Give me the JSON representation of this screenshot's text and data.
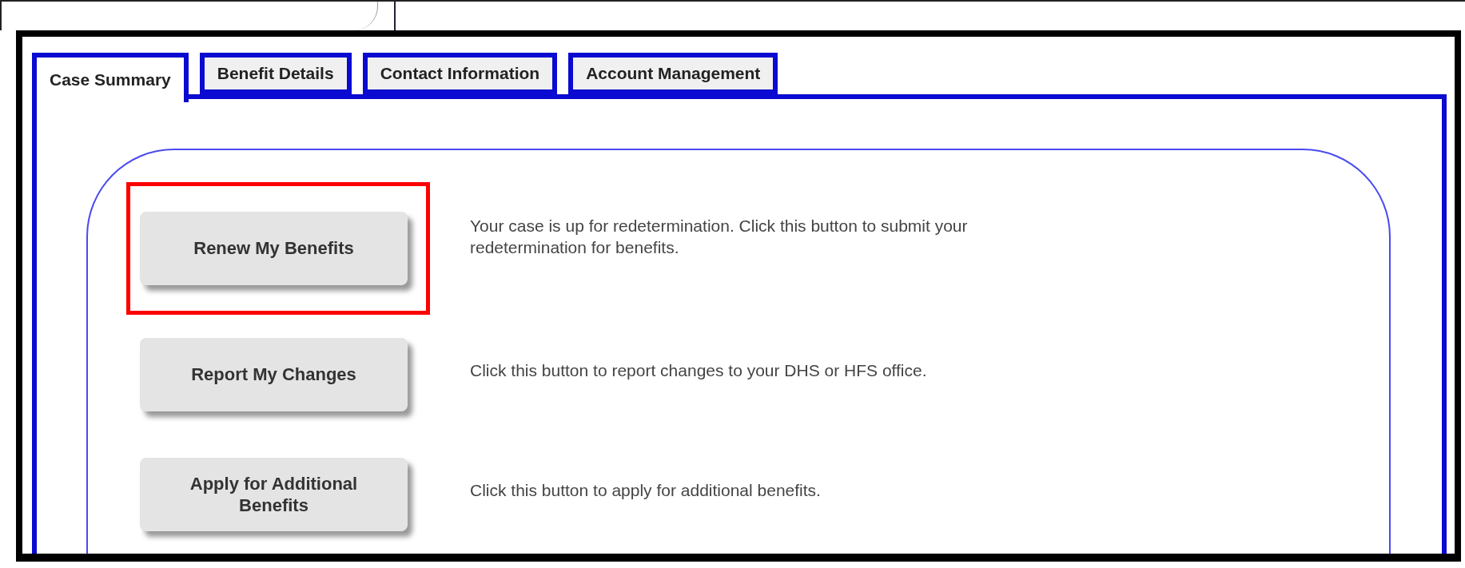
{
  "tabs": [
    {
      "label": "Case Summary",
      "selected": true
    },
    {
      "label": "Benefit Details",
      "selected": false
    },
    {
      "label": "Contact Information",
      "selected": false
    },
    {
      "label": "Account Management",
      "selected": false
    }
  ],
  "actions": [
    {
      "button": "Renew My Benefits",
      "description": "Your case is up for redetermination. Click this button to submit your redetermination for benefits.",
      "highlighted": true
    },
    {
      "button": "Report My Changes",
      "description": "Click this button to report changes to your DHS or HFS office.",
      "highlighted": false
    },
    {
      "button": "Apply for Additional Benefits",
      "description": "Click this button to apply for additional benefits.",
      "highlighted": false
    }
  ]
}
